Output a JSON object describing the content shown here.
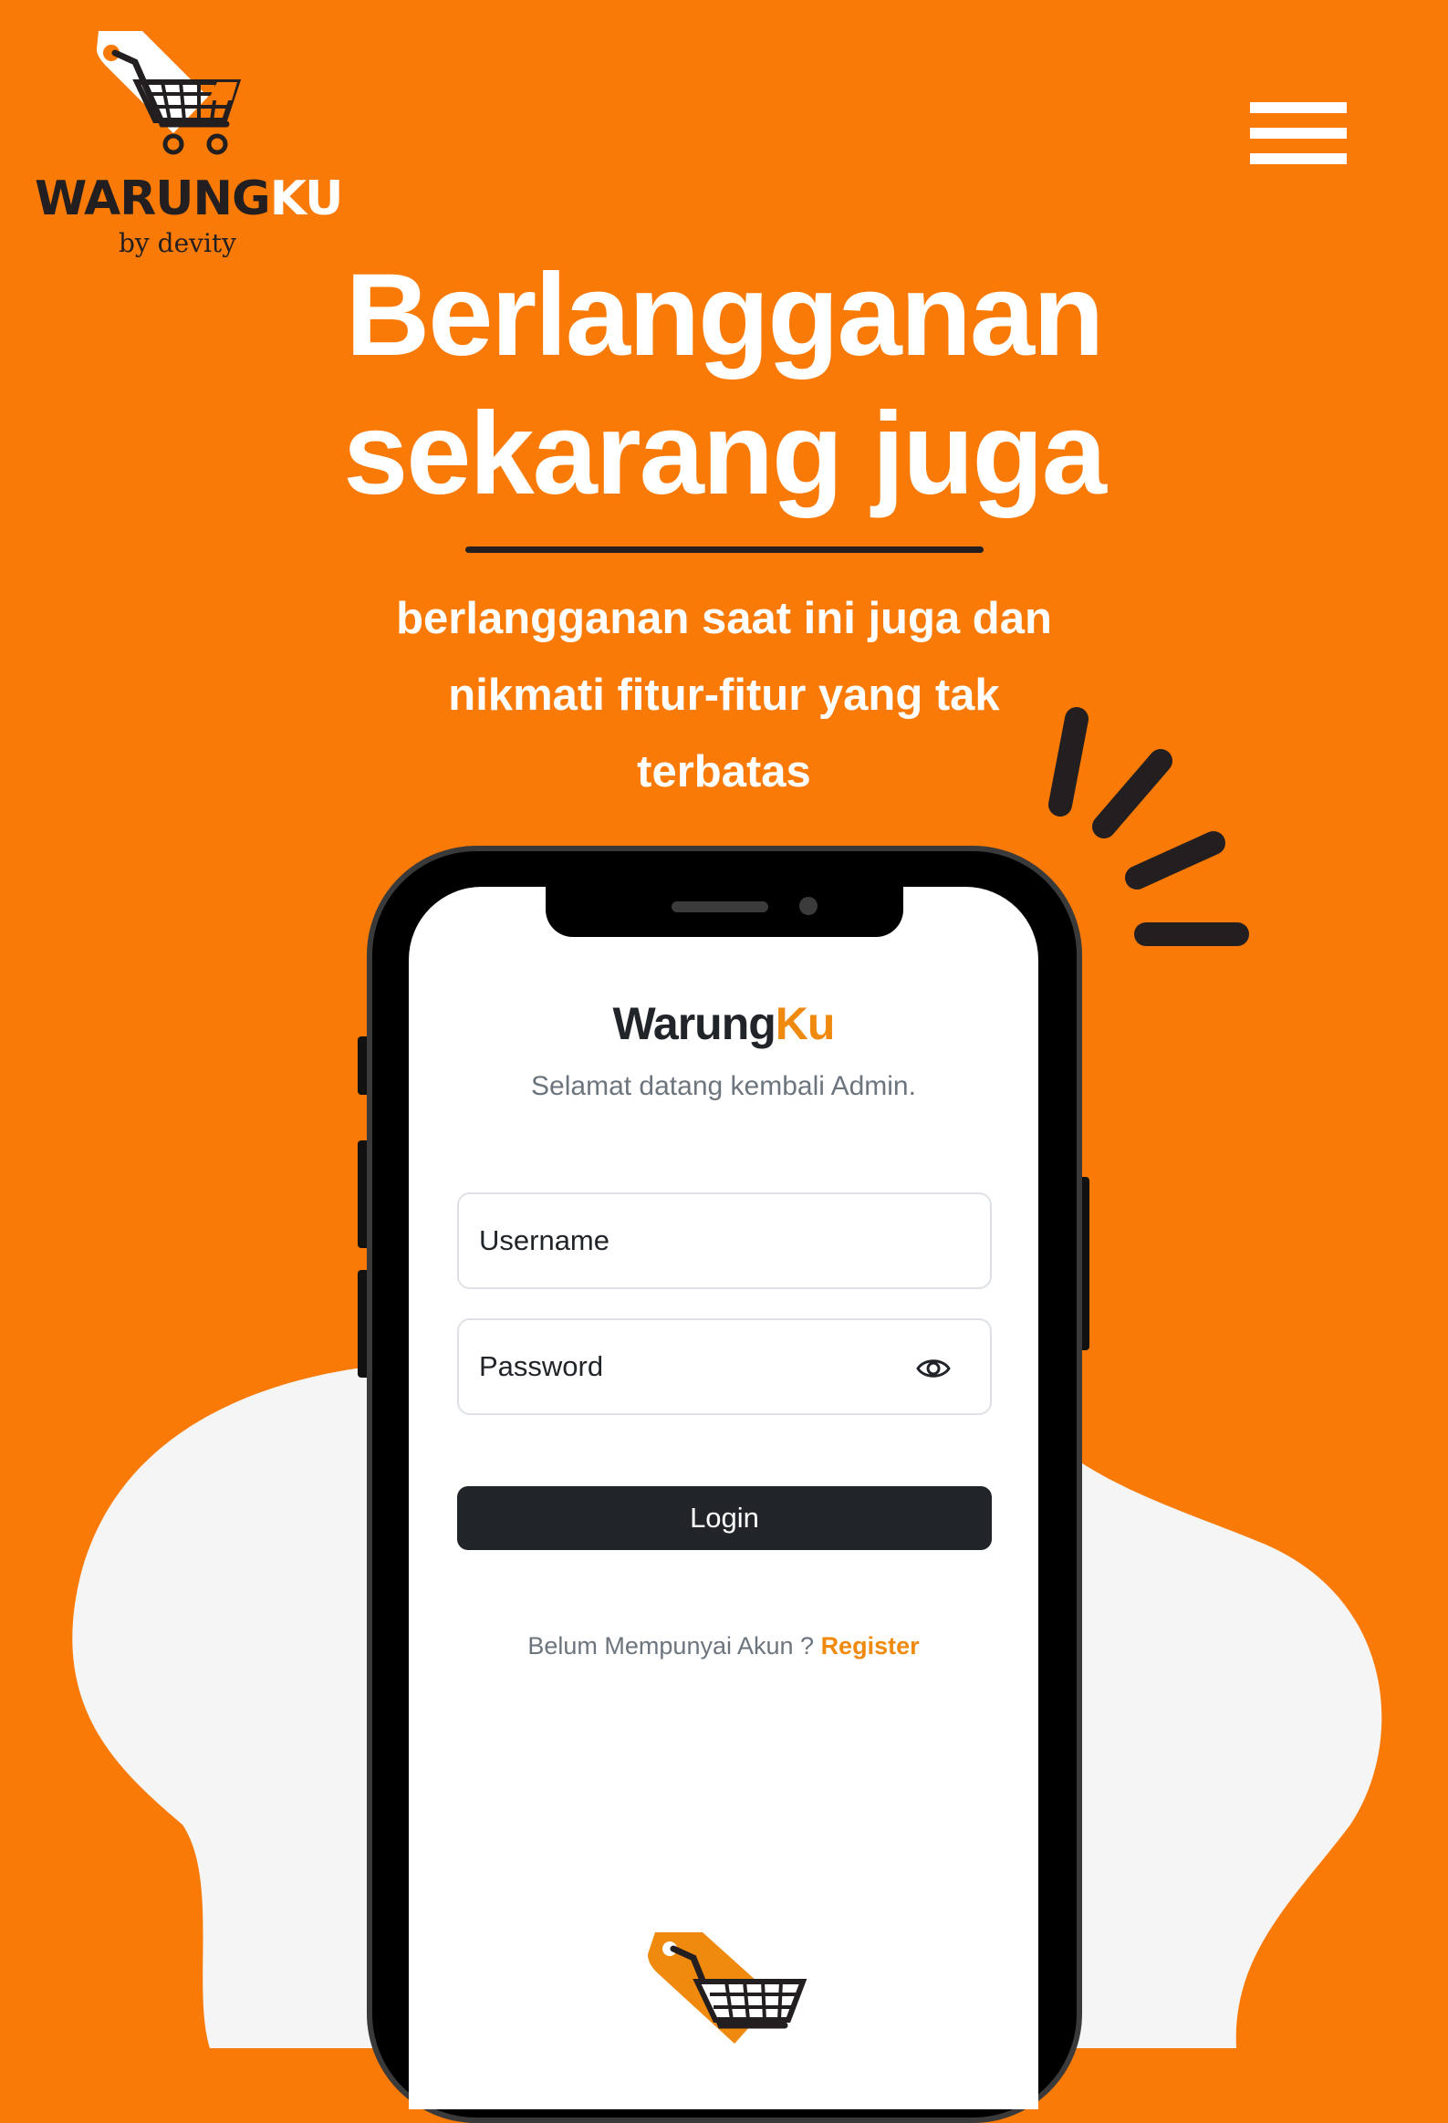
{
  "brand": {
    "logo_word_dark": "WARUNG",
    "logo_word_light": "KU",
    "logo_tagline": "by devity"
  },
  "nav": {
    "menu_icon": "hamburger-menu-icon"
  },
  "hero": {
    "title_line1": "Berlangganan",
    "title_line2": "sekarang juga",
    "subtitle_line1": "berlangganan saat ini juga dan",
    "subtitle_line2": "nikmati fitur-fitur yang tak",
    "subtitle_line3": "terbatas"
  },
  "login": {
    "app_name_dark": "Warung",
    "app_name_accent": "Ku",
    "welcome": "Selamat datang kembali Admin.",
    "username_placeholder": "Username",
    "password_placeholder": "Password",
    "password_toggle_icon": "eye-icon",
    "login_label": "Login",
    "register_prompt": "Belum Mempunyai Akun ?",
    "register_link": "Register"
  },
  "colors": {
    "background": "#F97A06",
    "accent": "#F08A0E",
    "dark": "#212529",
    "blob": "#F5F5F5"
  }
}
